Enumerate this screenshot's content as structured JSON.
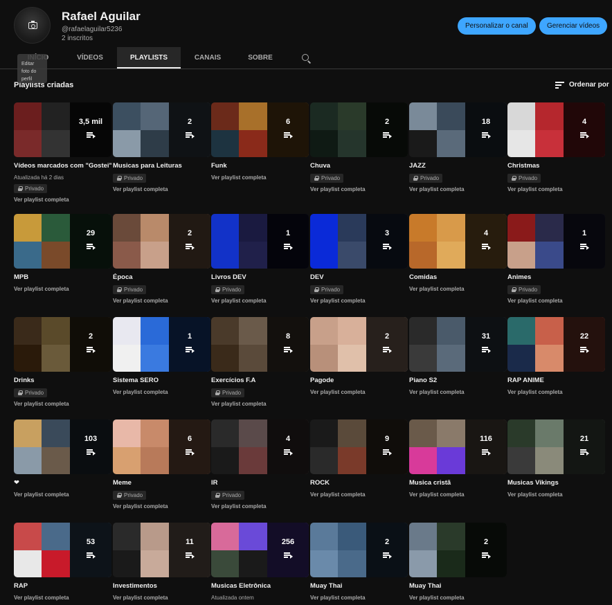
{
  "channel": {
    "name": "Rafael Aguilar",
    "handle": "@rafaelaguilar5236",
    "subscribers": "2 inscritos",
    "avatar_tooltip": "Editar foto do perfil",
    "customize_button": "Personalizar o canal",
    "manage_button": "Gerenciar vídeos"
  },
  "tabs": [
    "INÍCIO",
    "VÍDEOS",
    "PLAYLISTS",
    "CANAIS",
    "SOBRE"
  ],
  "section": {
    "title": "Playlists criadas",
    "sort_label": "Ordenar por"
  },
  "labels": {
    "private": "Privado",
    "view_full": "Ver playlist completa"
  },
  "colors": {
    "accent": "#3ea6ff",
    "background": "#0f0f0f"
  },
  "playlists": [
    {
      "title": "Vídeos marcados com \"Gostei\"",
      "count": "3,5 mil",
      "updated": "Atualizada há 2 dias",
      "private": true,
      "thumbs": [
        "#6b1e1e",
        "#222",
        "#7a2a2a",
        "#333"
      ]
    },
    {
      "title": "Musicas para Leituras",
      "count": "2",
      "private": true,
      "thumbs": [
        "#3c4f60",
        "#556677",
        "#8a9aa8",
        "#2e3c48"
      ]
    },
    {
      "title": "Funk",
      "count": "6",
      "private": false,
      "thumbs": [
        "#6b2a1a",
        "#a8702a",
        "#1d3340",
        "#8a2a1a"
      ]
    },
    {
      "title": "Chuva",
      "count": "2",
      "private": true,
      "thumbs": [
        "#1b2a22",
        "#2a3a2a",
        "#0f1a14",
        "#25352c"
      ]
    },
    {
      "title": "JAZZ",
      "count": "18",
      "private": true,
      "thumbs": [
        "#7a8a99",
        "#3a4a5a",
        "#1a1a1a",
        "#5a6a7a"
      ]
    },
    {
      "title": "Christmas",
      "count": "4",
      "private": true,
      "thumbs": [
        "#d8d8d8",
        "#b5272d",
        "#e6e6e6",
        "#c8303a"
      ]
    },
    {
      "title": "MPB",
      "count": "29",
      "private": false,
      "thumbs": [
        "#c89a3a",
        "#2a5a3a",
        "#3a6a8a",
        "#7a4a2a"
      ]
    },
    {
      "title": "Época",
      "count": "2",
      "private": true,
      "thumbs": [
        "#6a4a3a",
        "#b98a6a",
        "#8a5a4a",
        "#c8a08a"
      ]
    },
    {
      "title": "Livros DEV",
      "count": "1",
      "private": true,
      "thumbs": [
        "#1232c8",
        "#1a1a40",
        "#1232c8",
        "#20204a"
      ]
    },
    {
      "title": "DEV",
      "count": "3",
      "private": true,
      "thumbs": [
        "#0a2ad8",
        "#2a3a5a",
        "#0a2ad8",
        "#3a4a6a"
      ]
    },
    {
      "title": "Comidas",
      "count": "4",
      "private": false,
      "thumbs": [
        "#c87a2a",
        "#d89a4a",
        "#b8682a",
        "#e0aa5a"
      ]
    },
    {
      "title": "Animes",
      "count": "1",
      "private": true,
      "thumbs": [
        "#8a1a1a",
        "#2a2a4a",
        "#c8a08a",
        "#3a4a8a"
      ]
    },
    {
      "title": "Drinks",
      "count": "2",
      "private": true,
      "thumbs": [
        "#3a2a1a",
        "#5a4a2a",
        "#2a1a0a",
        "#6a5a3a"
      ]
    },
    {
      "title": "Sistema SERO",
      "count": "1",
      "private": false,
      "thumbs": [
        "#e8e8f0",
        "#2a6ad8",
        "#f0f0f0",
        "#3a7ae0"
      ]
    },
    {
      "title": "Exercícios F.A",
      "count": "8",
      "private": true,
      "thumbs": [
        "#4a3a2a",
        "#6a5a4a",
        "#3a2a1a",
        "#5a4a3a"
      ]
    },
    {
      "title": "Pagode",
      "count": "2",
      "private": false,
      "thumbs": [
        "#c8a08a",
        "#d8b09a",
        "#b8907a",
        "#e0c0aa"
      ]
    },
    {
      "title": "Piano S2",
      "count": "31",
      "private": false,
      "thumbs": [
        "#2a2a2a",
        "#4a5a6a",
        "#3a3a3a",
        "#5a6a7a"
      ]
    },
    {
      "title": "RAP ANIME",
      "count": "22",
      "private": false,
      "thumbs": [
        "#2a6a6a",
        "#c8604a",
        "#1a2a4a",
        "#d88a6a"
      ]
    },
    {
      "title": "❤",
      "count": "103",
      "private": false,
      "thumbs": [
        "#c8a060",
        "#3a4a5a",
        "#8a9aa8",
        "#6a5a4a"
      ]
    },
    {
      "title": "Meme",
      "count": "6",
      "private": true,
      "thumbs": [
        "#e8b8a8",
        "#c88a6a",
        "#d8a070",
        "#b87a5a"
      ]
    },
    {
      "title": "IR",
      "count": "4",
      "private": true,
      "thumbs": [
        "#2a2a2a",
        "#5a4a4a",
        "#1a1a1a",
        "#6a3a3a"
      ]
    },
    {
      "title": "ROCK",
      "count": "9",
      "private": false,
      "thumbs": [
        "#1a1a1a",
        "#5a4a3a",
        "#2a2a2a",
        "#7a3a2a"
      ]
    },
    {
      "title": "Musica cristã",
      "count": "116",
      "private": false,
      "thumbs": [
        "#6a5a4a",
        "#8a7a6a",
        "#d83a9a",
        "#6a3ad8"
      ]
    },
    {
      "title": "Musicas Vikings",
      "count": "21",
      "private": false,
      "thumbs": [
        "#2a3a2a",
        "#6a7a6a",
        "#3a3a3a",
        "#8a8a7a"
      ]
    },
    {
      "title": "RAP",
      "count": "53",
      "private": false,
      "thumbs": [
        "#c84a4a",
        "#4a6a8a",
        "#e8e8e8",
        "#c81a2a"
      ]
    },
    {
      "title": "Investimentos",
      "count": "11",
      "private": false,
      "thumbs": [
        "#2a2a2a",
        "#b89a8a",
        "#1a1a1a",
        "#c8aa9a"
      ]
    },
    {
      "title": "Musicas Eletrônica",
      "count": "256",
      "updated": "Atualizada ontem",
      "private": false,
      "thumbs": [
        "#d86a9a",
        "#6a4ad8",
        "#3a4a3a",
        "#1a1a1a"
      ]
    },
    {
      "title": "Muay Thai",
      "count": "2",
      "private": false,
      "thumbs": [
        "#5a7a9a",
        "#3a5a7a",
        "#6a8aaa",
        "#4a6a8a"
      ]
    },
    {
      "title": "Muay Thai",
      "count": "2",
      "private": false,
      "thumbs": [
        "#6a7a8a",
        "#2a3a2a",
        "#8a9aaa",
        "#1a2a1a"
      ]
    }
  ]
}
